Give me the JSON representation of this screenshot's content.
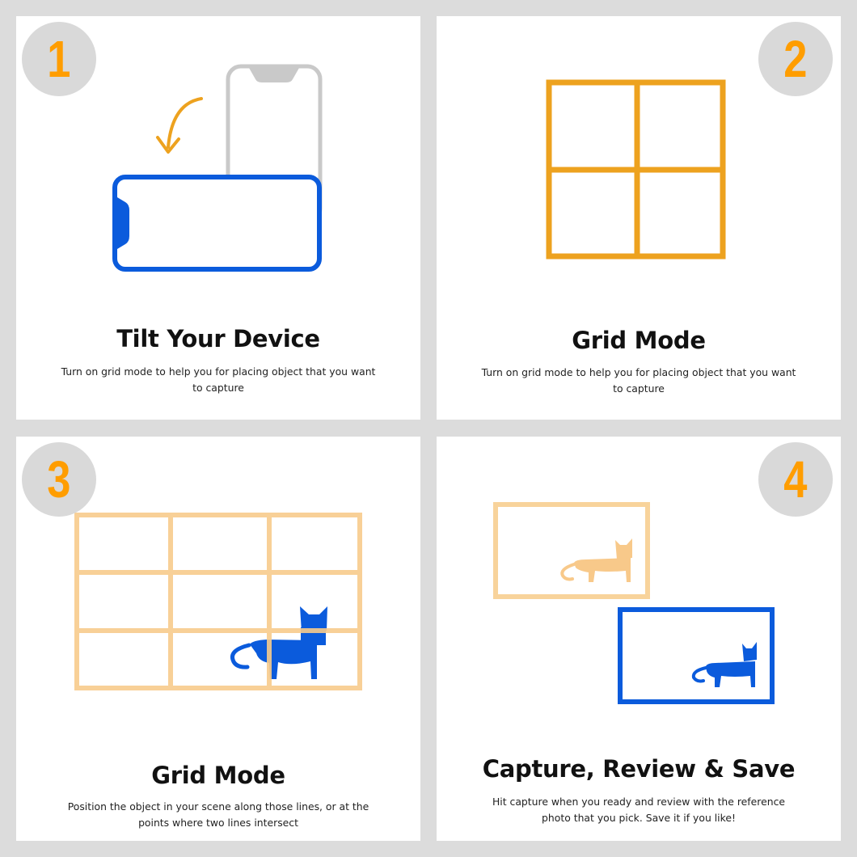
{
  "steps": [
    {
      "number": "1",
      "title": "Tilt Your Device",
      "description": "Turn on grid mode to help you for placing object that you want to capture"
    },
    {
      "number": "2",
      "title": "Grid Mode",
      "description": "Turn on grid mode to help you for placing object that you want to capture"
    },
    {
      "number": "3",
      "title": "Grid Mode",
      "description": "Position the object in your scene along those lines, or at the points where two lines intersect"
    },
    {
      "number": "4",
      "title": "Capture, Review & Save",
      "description": "Hit capture when you ready and review with the reference photo that you pick. Save it if you like!"
    }
  ],
  "colors": {
    "background": "#dcdcdc",
    "panel": "#ffffff",
    "badge": "#d9d9d9",
    "badge_number": "#ff9d00",
    "orange": "#eda21f",
    "light_orange": "#f8d39b",
    "blue": "#0b5bdc",
    "gray_phone": "#c9c9c9"
  },
  "icons": [
    "rotate-arrow-icon",
    "portrait-phone-icon",
    "landscape-phone-icon",
    "grid-2x2-icon",
    "grid-3x3-icon",
    "cat-icon"
  ]
}
